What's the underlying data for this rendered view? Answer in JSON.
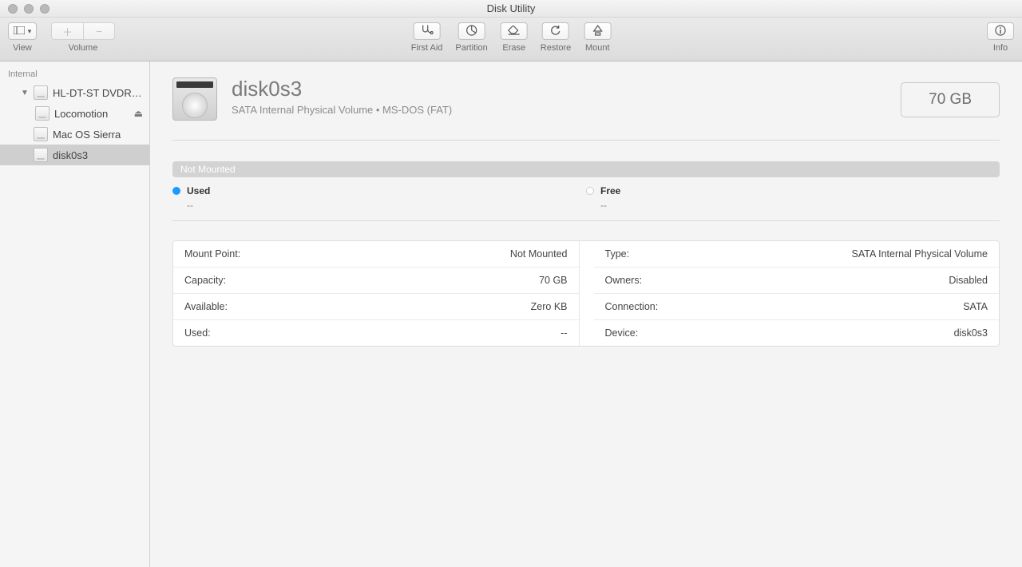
{
  "window": {
    "title": "Disk Utility"
  },
  "toolbar": {
    "view_label": "View",
    "volume_label": "Volume",
    "first_aid": "First Aid",
    "partition": "Partition",
    "erase": "Erase",
    "restore": "Restore",
    "mount": "Mount",
    "info": "Info"
  },
  "sidebar": {
    "section": "Internal",
    "items": [
      {
        "label": "HL-DT-ST DVDR…",
        "depth": 1,
        "expanded": true,
        "eject": false,
        "selected": false
      },
      {
        "label": "Locomotion",
        "depth": 2,
        "expanded": false,
        "eject": true,
        "selected": false
      },
      {
        "label": "Mac OS Sierra",
        "depth": 1,
        "expanded": false,
        "eject": false,
        "selected": false
      },
      {
        "label": "disk0s3",
        "depth": 1,
        "expanded": false,
        "eject": false,
        "selected": true
      }
    ]
  },
  "volume": {
    "name": "disk0s3",
    "subtitle": "SATA Internal Physical Volume • MS-DOS (FAT)",
    "capacity_box": "70 GB"
  },
  "usage": {
    "bar_label": "Not Mounted",
    "used_label": "Used",
    "used_value": "--",
    "free_label": "Free",
    "free_value": "--"
  },
  "details": {
    "left": [
      {
        "k": "Mount Point:",
        "v": "Not Mounted"
      },
      {
        "k": "Capacity:",
        "v": "70 GB"
      },
      {
        "k": "Available:",
        "v": "Zero KB"
      },
      {
        "k": "Used:",
        "v": "--"
      }
    ],
    "right": [
      {
        "k": "Type:",
        "v": "SATA Internal Physical Volume"
      },
      {
        "k": "Owners:",
        "v": "Disabled"
      },
      {
        "k": "Connection:",
        "v": "SATA"
      },
      {
        "k": "Device:",
        "v": "disk0s3"
      }
    ]
  }
}
